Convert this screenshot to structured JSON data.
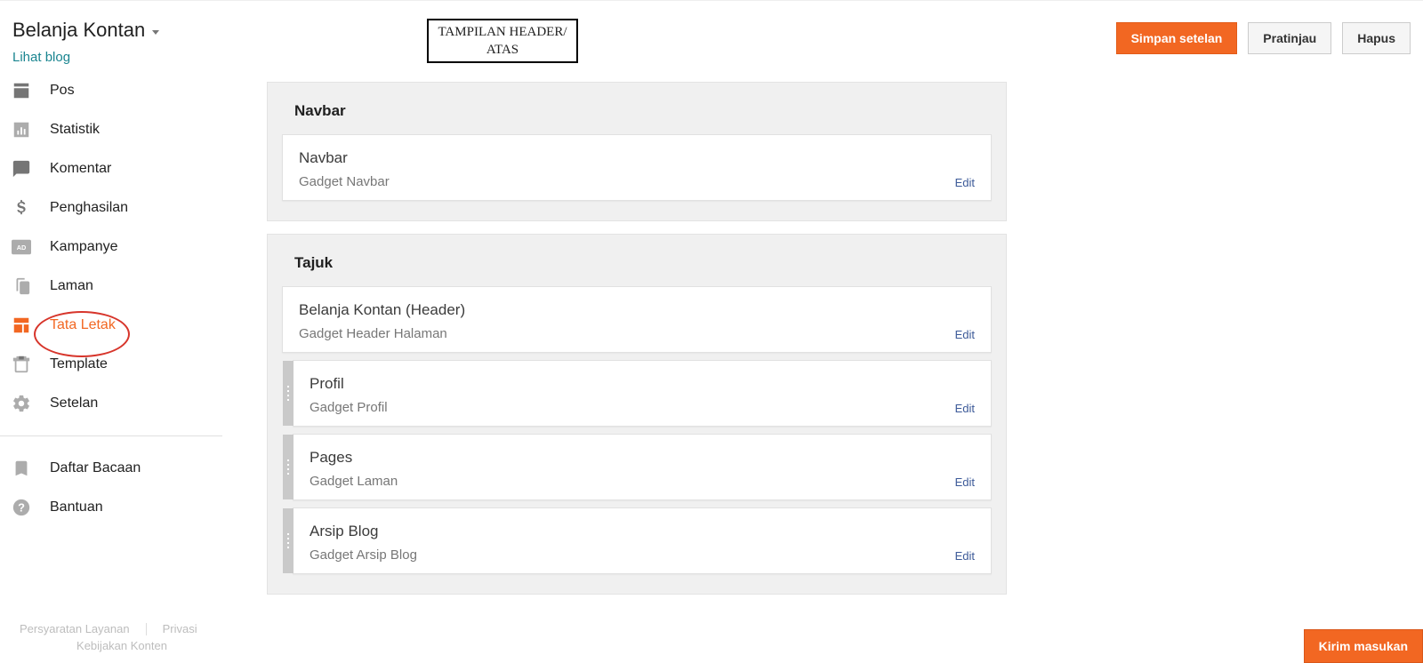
{
  "header": {
    "blog_title": "Belanja Kontan",
    "view_blog": "Lihat blog",
    "annotation": "TAMPILAN HEADER/ ATAS",
    "actions": {
      "save": "Simpan setelan",
      "preview": "Pratinjau",
      "delete": "Hapus"
    }
  },
  "sidebar": {
    "items": [
      {
        "label": "Pos"
      },
      {
        "label": "Statistik"
      },
      {
        "label": "Komentar"
      },
      {
        "label": "Penghasilan"
      },
      {
        "label": "Kampanye"
      },
      {
        "label": "Laman"
      },
      {
        "label": "Tata Letak"
      },
      {
        "label": "Template"
      },
      {
        "label": "Setelan"
      }
    ],
    "secondary": [
      {
        "label": "Daftar Bacaan"
      },
      {
        "label": "Bantuan"
      }
    ]
  },
  "footer": {
    "terms": "Persyaratan Layanan",
    "privacy": "Privasi",
    "content_policy": "Kebijakan Konten"
  },
  "layout": {
    "sections": [
      {
        "title": "Navbar",
        "gadgets": [
          {
            "title": "Navbar",
            "subtitle": "Gadget Navbar",
            "edit": "Edit",
            "draggable": false
          }
        ]
      },
      {
        "title": "Tajuk",
        "gadgets": [
          {
            "title": "Belanja Kontan (Header)",
            "subtitle": "Gadget Header Halaman",
            "edit": "Edit",
            "draggable": false
          },
          {
            "title": "Profil",
            "subtitle": "Gadget Profil",
            "edit": "Edit",
            "draggable": true
          },
          {
            "title": "Pages",
            "subtitle": "Gadget Laman",
            "edit": "Edit",
            "draggable": true
          },
          {
            "title": "Arsip Blog",
            "subtitle": "Gadget Arsip Blog",
            "edit": "Edit",
            "draggable": true
          }
        ]
      }
    ]
  },
  "feedback": "Kirim masukan"
}
